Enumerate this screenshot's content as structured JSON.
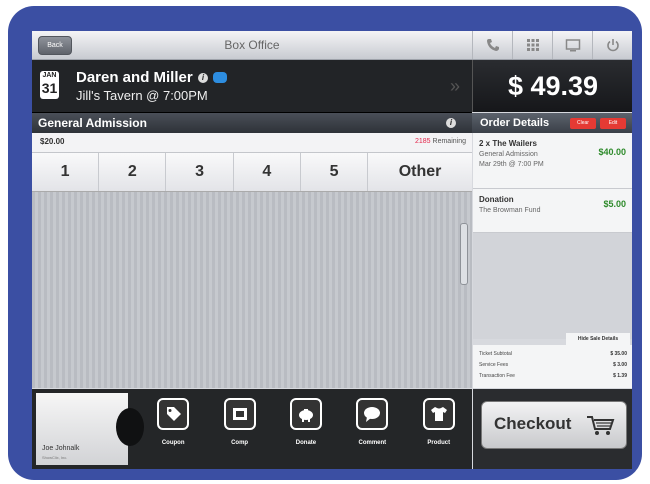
{
  "topbar": {
    "back_label": "Back",
    "title": "Box Office",
    "icons": [
      "phone-icon",
      "grid-icon",
      "display-icon",
      "power-icon"
    ]
  },
  "event": {
    "month": "JAN",
    "day": "31",
    "name": "Daren and Miller",
    "venue": "Jill's Tavern @ 7:00PM"
  },
  "total": "$ 49.39",
  "ticket": {
    "name": "General Admission",
    "price": "$20.00",
    "remaining_count": "2185",
    "remaining_label": " Remaining"
  },
  "quantity": [
    "1",
    "2",
    "3",
    "4",
    "5",
    "Other"
  ],
  "order": {
    "title": "Order Details",
    "clear_label": "Clear",
    "edit_label": "Edit",
    "items": [
      {
        "name": "2 x The Wailers",
        "line1": "General Admission",
        "line2": "Mar 29th @ 7:00 PM",
        "amount": "$40.00"
      },
      {
        "name": "Donation",
        "line1": "The Browman Fund",
        "amount": "$5.00"
      }
    ],
    "hide_label": "Hide Sale Details",
    "summary": [
      {
        "label": "Ticket Subtotal",
        "value": "$ 35.00"
      },
      {
        "label": "Service Fees",
        "value": "$ 3.00"
      },
      {
        "label": "Transaction Fee",
        "value": "$ 1.39"
      }
    ]
  },
  "user": {
    "name": "Joe Johnalk",
    "company": "ShowClix, Inc."
  },
  "tools": [
    {
      "label": "Coupon",
      "icon": "coupon-icon"
    },
    {
      "label": "Comp",
      "icon": "comp-icon"
    },
    {
      "label": "Donate",
      "icon": "donate-icon"
    },
    {
      "label": "Comment",
      "icon": "comment-icon"
    },
    {
      "label": "Product",
      "icon": "product-icon"
    }
  ],
  "checkout_label": "Checkout"
}
